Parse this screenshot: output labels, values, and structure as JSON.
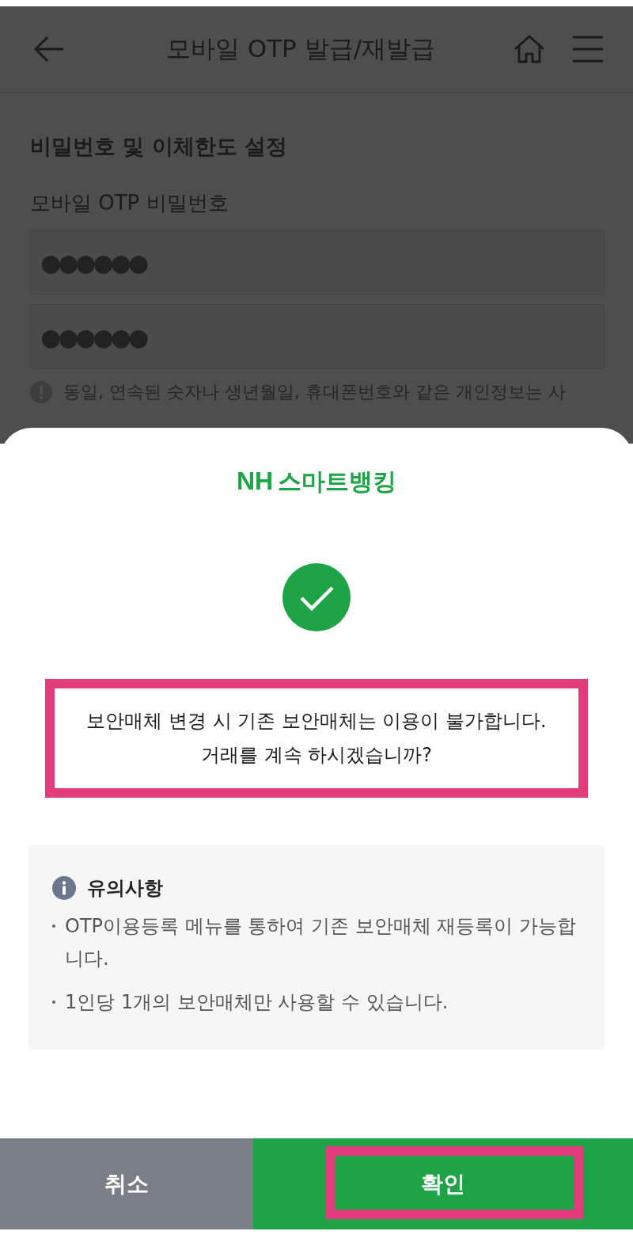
{
  "header": {
    "title": "모바일 OTP 발급/재발급"
  },
  "section_title": "비밀번호 및 이체한도 설정",
  "password_label": "모바일 OTP 비밀번호",
  "password_fields": [
    {
      "value": "●●●●●●"
    },
    {
      "value": "●●●●●●"
    }
  ],
  "hint": "동일, 연속된 숫자나 생년월일, 휴대폰번호와 같은 개인정보는 사",
  "dialog": {
    "logo": {
      "mark": "NH",
      "text": "스마트뱅킹"
    },
    "message": {
      "text": "보안매체 변경 시 기존 보안매체는 이용이 불가합니다.\n거래를 계속 하시겠습니까?",
      "highlighted": true
    },
    "notice": {
      "title": "유의사항",
      "items": [
        "OTP이용등록 메뉴를 통하여 기존 보안매체 재등록이 가능합니다.",
        "1인당 1개의 보안매체만 사용할 수 있습니다."
      ]
    },
    "buttons": [
      {
        "kind": "cancel",
        "label": "취소",
        "highlighted": false
      },
      {
        "kind": "confirm",
        "label": "확인",
        "highlighted": true
      }
    ]
  }
}
